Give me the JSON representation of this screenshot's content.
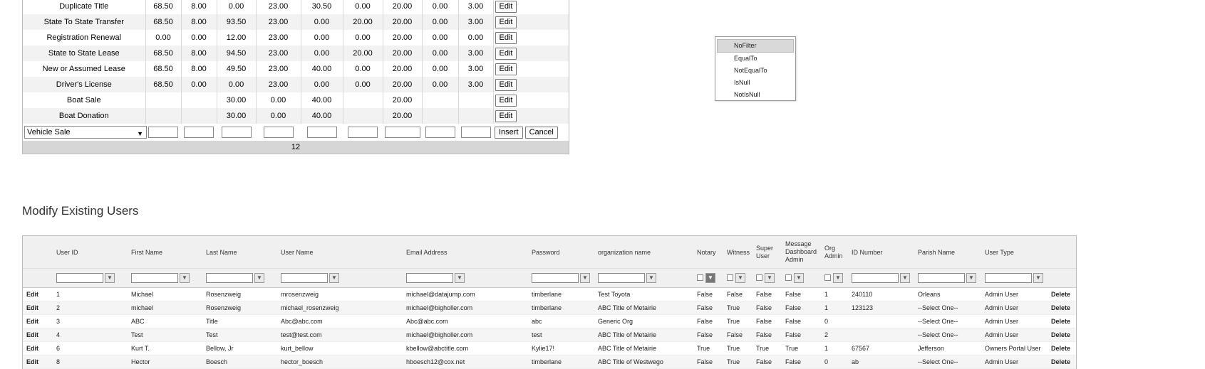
{
  "fees": {
    "rows": [
      {
        "name": "Duplicate Title",
        "v": [
          "68.50",
          "8.00",
          "0.00",
          "23.00",
          "30.50",
          "0.00",
          "20.00",
          "0.00",
          "3.00"
        ]
      },
      {
        "name": "State To State Transfer",
        "v": [
          "68.50",
          "8.00",
          "93.50",
          "23.00",
          "0.00",
          "20.00",
          "20.00",
          "0.00",
          "3.00"
        ]
      },
      {
        "name": "Registration Renewal",
        "v": [
          "0.00",
          "0.00",
          "12.00",
          "23.00",
          "0.00",
          "0.00",
          "20.00",
          "0.00",
          "0.00"
        ]
      },
      {
        "name": "State to State Lease",
        "v": [
          "68.50",
          "8.00",
          "94.50",
          "23.00",
          "0.00",
          "20.00",
          "20.00",
          "0.00",
          "3.00"
        ]
      },
      {
        "name": "New or Assumed Lease",
        "v": [
          "68.50",
          "8.00",
          "49.50",
          "23.00",
          "40.00",
          "0.00",
          "20.00",
          "0.00",
          "3.00"
        ]
      },
      {
        "name": "Driver's License",
        "v": [
          "68.50",
          "0.00",
          "0.00",
          "23.00",
          "0.00",
          "0.00",
          "20.00",
          "0.00",
          "3.00"
        ]
      },
      {
        "name": "Boat Sale",
        "v": [
          "",
          "",
          "30.00",
          "0.00",
          "40.00",
          "",
          "20.00",
          "",
          ""
        ]
      },
      {
        "name": "Boat Donation",
        "v": [
          "",
          "",
          "30.00",
          "0.00",
          "40.00",
          "",
          "20.00",
          "",
          ""
        ]
      }
    ],
    "edit_label": "Edit",
    "insert_label": "Insert",
    "cancel_label": "Cancel",
    "type_select_value": "Vehicle Sale",
    "pager_label": "12"
  },
  "filter_menu": {
    "options": [
      "NoFilter",
      "EqualTo",
      "NotEqualTo",
      "IsNull",
      "NotIsNull"
    ],
    "selected": "NoFilter"
  },
  "users": {
    "title": "Modify Existing Users",
    "headers": {
      "user_id": "User ID",
      "first_name": "First Name",
      "last_name": "Last Name",
      "user_name": "User Name",
      "email": "Email Address",
      "password": "Password",
      "org_name": "organization name",
      "notary": "Notary",
      "witness": "Witness",
      "super_user": "Super User",
      "msg_admin": "Message Dashboard Admin",
      "org_admin": "Org Admin",
      "id_number": "ID Number",
      "parish": "Parish Name",
      "user_type": "User Type"
    },
    "edit_label": "Edit",
    "delete_label": "Delete",
    "rows": [
      {
        "id": "1",
        "first": "Michael",
        "last": "Rosenzweig",
        "user": "mrosenzweig",
        "email": "michael@datajump.com",
        "password": "timberlane",
        "org": "Test Toyota",
        "notary": "False",
        "witness": "False",
        "super": "False",
        "msg": "False",
        "orgadmin": "1",
        "idnum": "240110",
        "parish": "Orleans",
        "type": "Admin User"
      },
      {
        "id": "2",
        "first": "michael",
        "last": "Rosenzweig",
        "user": "michael_rosenzweig",
        "email": "michael@bigholler.com",
        "password": "timberlane",
        "org": "ABC Title of Metairie",
        "notary": "False",
        "witness": "True",
        "super": "False",
        "msg": "False",
        "orgadmin": "1",
        "idnum": "123123",
        "parish": "--Select One--",
        "type": "Admin User"
      },
      {
        "id": "3",
        "first": "ABC",
        "last": "Title",
        "user": "Abc@abc.com",
        "email": "Abc@abc.com",
        "password": "abc",
        "org": "Generic Org",
        "notary": "False",
        "witness": "True",
        "super": "False",
        "msg": "False",
        "orgadmin": "0",
        "idnum": "",
        "parish": "--Select One--",
        "type": "Admin User"
      },
      {
        "id": "4",
        "first": "Test",
        "last": "Test",
        "user": "test@test.com",
        "email": "michael@bigholler.com",
        "password": "test",
        "org": "ABC Title of Metairie",
        "notary": "False",
        "witness": "False",
        "super": "False",
        "msg": "False",
        "orgadmin": "2",
        "idnum": "",
        "parish": "--Select One--",
        "type": "Admin User"
      },
      {
        "id": "6",
        "first": "Kurt T.",
        "last": "Bellow, Jr",
        "user": "kurt_bellow",
        "email": "kbellow@abctitle.com",
        "password": "Kylie17!",
        "org": "ABC Title of Metairie",
        "notary": "True",
        "witness": "True",
        "super": "True",
        "msg": "True",
        "orgadmin": "1",
        "idnum": "67567",
        "parish": "Jefferson",
        "type": "Owners Portal User"
      },
      {
        "id": "8",
        "first": "Hector",
        "last": "Boesch",
        "user": "hector_boesch",
        "email": "hboesch12@cox.net",
        "password": "timberlane",
        "org": "ABC Title of Westwego",
        "notary": "False",
        "witness": "True",
        "super": "False",
        "msg": "False",
        "orgadmin": "0",
        "idnum": "ab",
        "parish": "--Select One--",
        "type": "Admin User"
      }
    ]
  },
  "icons": {
    "filter": "filter-icon",
    "dropdown": "chevron-down-icon"
  }
}
